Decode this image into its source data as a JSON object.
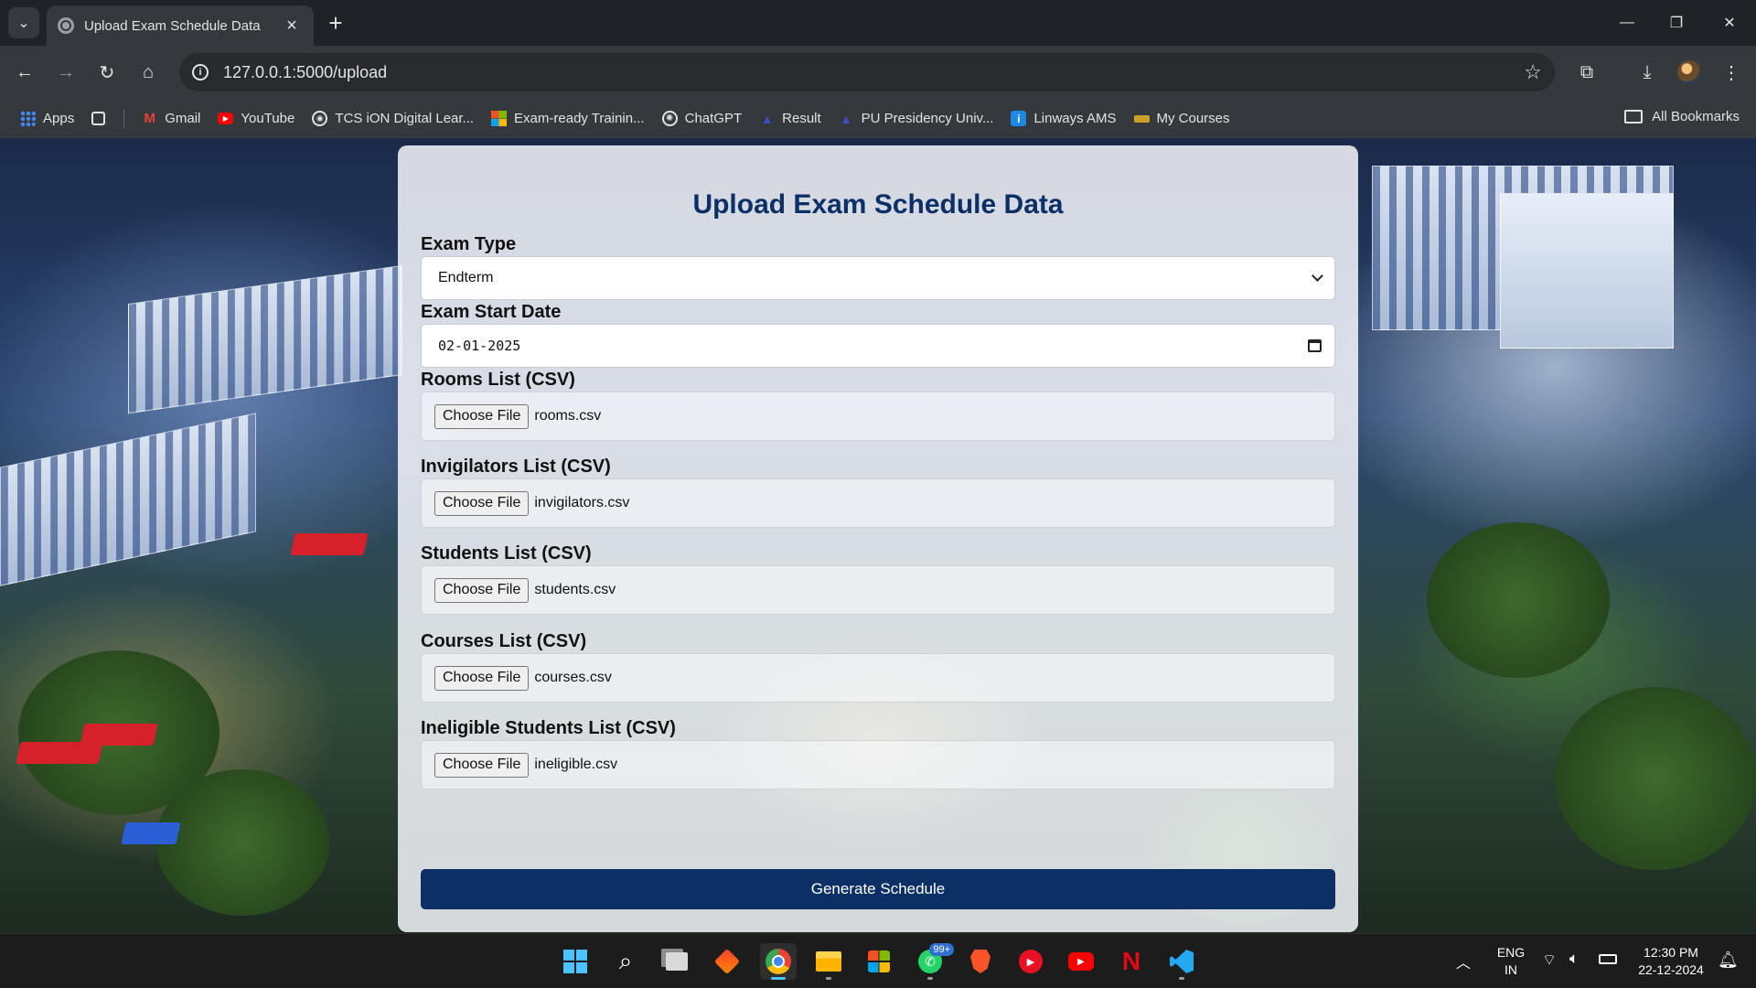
{
  "browser": {
    "tab_title": "Upload Exam Schedule Data",
    "url": "127.0.0.1:5000/upload",
    "bookmarks": [
      {
        "label": "Apps",
        "icon": "apps-grid-icon"
      },
      {
        "label": "Gmail",
        "icon": "gmail-icon"
      },
      {
        "label": "YouTube",
        "icon": "youtube-icon"
      },
      {
        "label": "TCS iON Digital Lear...",
        "icon": "tcs-ion-icon"
      },
      {
        "label": "Exam-ready Trainin...",
        "icon": "microsoft-icon"
      },
      {
        "label": "ChatGPT",
        "icon": "chatgpt-icon"
      },
      {
        "label": "Result",
        "icon": "result-icon"
      },
      {
        "label": "PU Presidency Univ...",
        "icon": "pu-icon"
      },
      {
        "label": "Linways AMS",
        "icon": "linways-icon"
      },
      {
        "label": "My Courses",
        "icon": "courses-icon"
      }
    ],
    "all_bookmarks_label": "All Bookmarks"
  },
  "page": {
    "title": "Upload Exam Schedule Data",
    "exam_type": {
      "label": "Exam Type",
      "selected": "Endterm"
    },
    "exam_start_date": {
      "label": "Exam Start Date",
      "value": "02-01-2025"
    },
    "file_fields": [
      {
        "label": "Rooms List (CSV)",
        "button": "Choose File",
        "file": "rooms.csv"
      },
      {
        "label": "Invigilators List (CSV)",
        "button": "Choose File",
        "file": "invigilators.csv"
      },
      {
        "label": "Students List (CSV)",
        "button": "Choose File",
        "file": "students.csv"
      },
      {
        "label": "Courses List (CSV)",
        "button": "Choose File",
        "file": "courses.csv"
      },
      {
        "label": "Ineligible Students List (CSV)",
        "button": "Choose File",
        "file": "ineligible.csv"
      }
    ],
    "submit_label": "Generate Schedule"
  },
  "taskbar": {
    "apps": [
      "windows-start-icon",
      "search-icon",
      "task-view-icon",
      "app-red-diamond-icon",
      "chrome-icon",
      "file-explorer-icon",
      "microsoft-store-icon",
      "whatsapp-icon",
      "brave-icon",
      "media-player-icon",
      "youtube-icon",
      "netflix-icon",
      "vscode-icon"
    ],
    "whatsapp_badge": "99+",
    "language": "ENG",
    "region": "IN",
    "time": "12:30 PM",
    "date": "22-12-2024"
  },
  "colors": {
    "primary": "#0c2f66",
    "chrome_bg": "#35383d",
    "tab_strip_bg": "#1f2226",
    "taskbar_bg": "#1c1c1c"
  }
}
